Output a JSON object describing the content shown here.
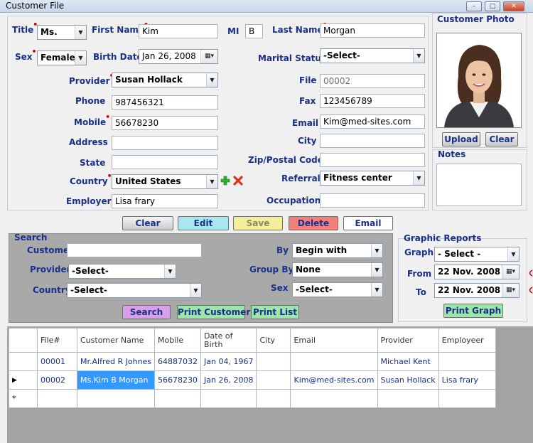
{
  "window": {
    "title": "Customer File",
    "min": "–",
    "max": "□",
    "close": "✕"
  },
  "form": {
    "title_label": "Title",
    "title_value": "Ms.",
    "first_name_label": "First Name",
    "first_name": "Kim",
    "mi_label": "MI",
    "mi": "B",
    "last_name_label": "Last Name",
    "last_name": "Morgan",
    "sex_label": "Sex",
    "sex": "Female",
    "birth_date_label": "Birth Date",
    "birth_date": "Jan 26, 2008",
    "marital_label": "Marital Status",
    "marital": "-Select-",
    "provider_label": "Provider",
    "provider": "Susan Hollack",
    "file_label": "File",
    "file": "00002",
    "phone_label": "Phone",
    "phone": "987456321",
    "fax_label": "Fax",
    "fax": "123456789",
    "mobile_label": "Mobile",
    "mobile": "56678230",
    "email_label": "Email",
    "email": "Kim@med-sites.com",
    "address_label": "Address",
    "address": "",
    "city_label": "City",
    "city": "",
    "state_label": "State",
    "state": "",
    "zip_label": "Zip/Postal Code",
    "zip": "",
    "country_label": "Country",
    "country": "United States",
    "referral_label": "Referral",
    "referral": "Fitness center",
    "employer_label": "Employer",
    "employer": "Lisa frary",
    "occupation_label": "Occupation",
    "occupation": ""
  },
  "photo": {
    "label": "Customer Photo",
    "upload": "Upload",
    "clear": "Clear"
  },
  "notes": {
    "label": "Notes",
    "value": ""
  },
  "actions": {
    "clear": "Clear",
    "edit": "Edit",
    "save": "Save",
    "delete": "Delete",
    "email": "Email"
  },
  "search": {
    "label": "Search",
    "customer_label": "Customer",
    "customer": "",
    "provider_label": "Provider",
    "provider": "-Select-",
    "country_label": "Country",
    "country": "-Select-",
    "by_label": "By",
    "by": "Begin with",
    "group_by_label": "Group By",
    "group_by": "None",
    "sex_label": "Sex",
    "sex": "-Select-",
    "search_btn": "Search",
    "print_customer": "Print Customer",
    "print_list": "Print List"
  },
  "graphic": {
    "label": "Graphic Reports",
    "graph_label": "Graph",
    "graph": "- Select -",
    "from_label": "From",
    "from": "22 Nov. 2008",
    "to_label": "To",
    "to": "22 Nov. 2008",
    "print_graph": "Print Graph"
  },
  "grid": {
    "columns": [
      "File#",
      "Customer Name",
      "Mobile",
      "Date of Birth",
      "City",
      "Email",
      "Provider",
      "Employeer"
    ],
    "rows": [
      [
        "00001",
        "Mr.Alfred R Johnes",
        "64887032",
        "Jan 04, 1967",
        "",
        "",
        "Michael Kent",
        ""
      ],
      [
        "00002",
        "Ms.Kim B Morgan",
        "56678230",
        "Jan 26, 2008",
        "",
        "Kim@med-sites.com",
        "Susan Hollack",
        "Lisa frary"
      ]
    ],
    "current_row_marker": "▶",
    "new_row_marker": "*"
  },
  "icons": {
    "add": "add-icon",
    "remove": "remove-icon"
  },
  "colors": {
    "label": "#1a2f8a",
    "required": "#d00000",
    "search_bg": "#a9a9a9"
  }
}
